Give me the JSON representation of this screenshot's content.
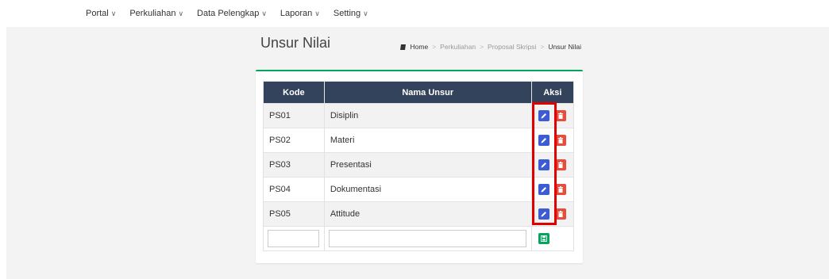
{
  "nav": {
    "items": [
      "Portal",
      "Perkuliahan",
      "Data Pelengkap",
      "Laporan",
      "Setting"
    ]
  },
  "page": {
    "title": "Unsur Nilai"
  },
  "breadcrumb": {
    "home": "Home",
    "items": [
      "Perkuliahan",
      "Proposal Skripsi"
    ],
    "active": "Unsur Nilai",
    "separator": ">"
  },
  "table": {
    "headers": {
      "kode": "Kode",
      "nama": "Nama Unsur",
      "aksi": "Aksi"
    },
    "rows": [
      {
        "kode": "PS01",
        "nama": "Disiplin"
      },
      {
        "kode": "PS02",
        "nama": "Materi"
      },
      {
        "kode": "PS03",
        "nama": "Presentasi"
      },
      {
        "kode": "PS04",
        "nama": "Dokumentasi"
      },
      {
        "kode": "PS05",
        "nama": "Attitude"
      }
    ],
    "new_row": {
      "kode_value": "",
      "nama_value": ""
    }
  },
  "colors": {
    "header_bg": "#33435b",
    "panel_accent": "#00a65a",
    "edit_button": "#3c5bd4",
    "delete_button": "#e74c3c",
    "save_button": "#00a65a",
    "highlight": "#e00000"
  },
  "icons": {
    "caret": "chevron-down-icon",
    "breadcrumb": "book-icon",
    "edit": "pencil-icon",
    "delete": "trash-icon",
    "save": "floppy-disk-icon"
  }
}
